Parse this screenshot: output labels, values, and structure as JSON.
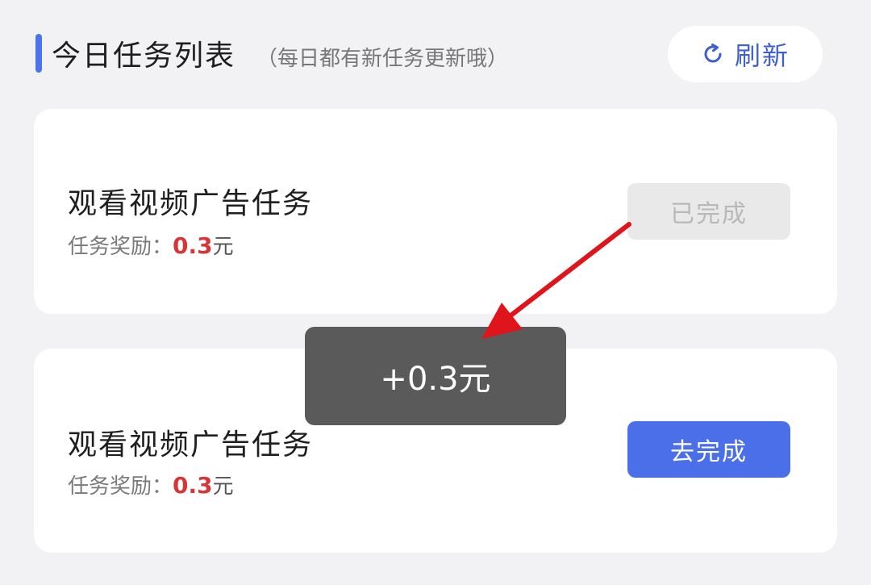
{
  "header": {
    "title": "今日任务列表",
    "subtitle": "（每日都有新任务更新哦）",
    "refresh_label": "刷新",
    "accent_color": "#4a73ee"
  },
  "tasks": [
    {
      "name": "观看视频广告任务",
      "reward_label": "任务奖励：",
      "reward_amount": "0.3",
      "reward_unit": "元",
      "button_label": "已完成",
      "status": "completed"
    },
    {
      "name": "观看视频广告任务",
      "reward_label": "任务奖励：",
      "reward_amount": "0.3",
      "reward_unit": "元",
      "button_label": "去完成",
      "status": "pending"
    }
  ],
  "toast": {
    "text": "+0.3元"
  },
  "colors": {
    "reward": "#d63636",
    "primary_button": "#4a6fe8",
    "annotation_arrow": "#e0141b"
  }
}
